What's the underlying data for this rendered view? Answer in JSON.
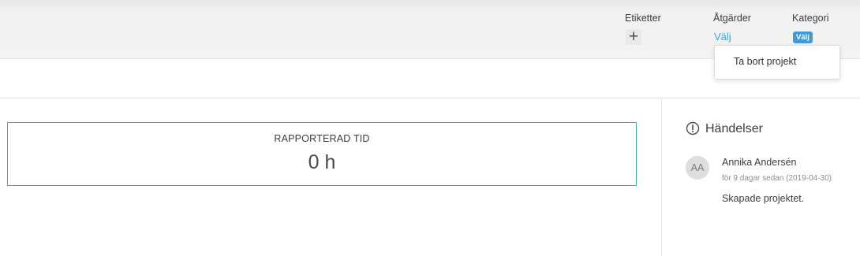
{
  "header": {
    "tags": {
      "label": "Etiketter",
      "add_symbol": "+"
    },
    "actions": {
      "label": "Åtgärder",
      "link": "Välj"
    },
    "category": {
      "label": "Kategori",
      "badge": "Välj"
    }
  },
  "actions_menu": {
    "items": [
      {
        "label": "Ta bort projekt"
      }
    ]
  },
  "reported_time": {
    "label": "RAPPORTERAD TID",
    "value": "0 h"
  },
  "events": {
    "title": "Händelser",
    "icon": "alert-circle-icon",
    "items": [
      {
        "initials": "AA",
        "author": "Annika Andersén",
        "time": "för 9 dagar sedan (2019-04-30)",
        "text": "Skapade projektet."
      }
    ]
  },
  "colors": {
    "accent_link": "#3aa3d9",
    "badge_bg": "#3f9bd8",
    "card_border": "#3fae9a"
  }
}
